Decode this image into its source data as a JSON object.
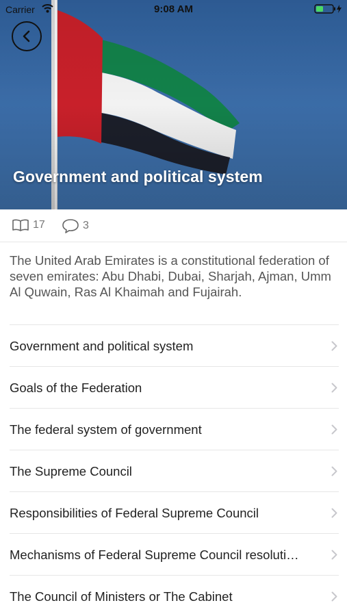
{
  "status_bar": {
    "carrier": "Carrier",
    "time": "9:08 AM"
  },
  "hero": {
    "title": "Government and political system"
  },
  "stats": {
    "reads": "17",
    "comments": "3"
  },
  "description": "The United Arab Emirates is a constitutional federation of seven emirates: Abu Dhabi, Dubai, Sharjah, Ajman, Umm Al Quwain, Ras Al Khaimah and Fujairah.",
  "list": {
    "items": [
      {
        "label": "Government and political system"
      },
      {
        "label": "Goals of the Federation"
      },
      {
        "label": "The federal system of government"
      },
      {
        "label": "The Supreme Council"
      },
      {
        "label": "Responsibilities of Federal Supreme Council"
      },
      {
        "label": "Mechanisms of Federal Supreme Council resoluti…"
      },
      {
        "label": "The Council of Ministers or The Cabinet"
      }
    ]
  },
  "colors": {
    "sky": "#3a6ba6",
    "flag_red": "#c8202a",
    "flag_green": "#12814a",
    "flag_white": "#ffffff",
    "flag_black": "#1c1f2a",
    "battery": "#4cd964",
    "chevron": "#c7c7cc"
  },
  "icons": {
    "back": "chevron-left-icon",
    "reads": "book-icon",
    "comments": "comment-icon",
    "row": "chevron-right-icon"
  }
}
